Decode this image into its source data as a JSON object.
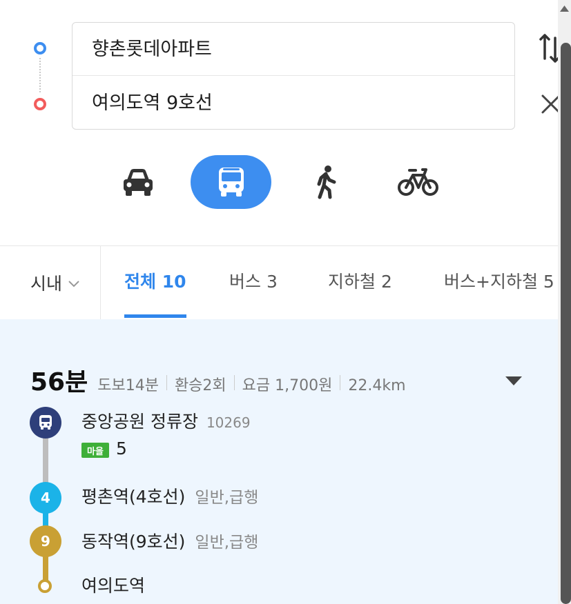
{
  "route": {
    "origin": "향촌롯데아파트",
    "destination": "여의도역 9호선",
    "swap_icon": "swap-vertical-icon",
    "clear_icon": "close-icon"
  },
  "modes": [
    {
      "name": "car",
      "icon": "car-icon",
      "selected": false
    },
    {
      "name": "transit",
      "icon": "bus-icon",
      "selected": true
    },
    {
      "name": "walk",
      "icon": "walk-icon",
      "selected": false
    },
    {
      "name": "bike",
      "icon": "bicycle-icon",
      "selected": false
    }
  ],
  "area_filter": "시내",
  "tabs": [
    {
      "label": "전체 10",
      "active": true
    },
    {
      "label": "버스 3",
      "active": false
    },
    {
      "label": "지하철 2",
      "active": false
    },
    {
      "label": "버스+지하철 5",
      "active": false
    }
  ],
  "result": {
    "duration": "56분",
    "walk": "도보14분",
    "transfers": "환승2회",
    "fare": "요금 1,700원",
    "distance": "22.4km",
    "steps": [
      {
        "kind": "bus",
        "name": "중앙공원 정류장",
        "stop_id": "10269",
        "badge": "마을",
        "route": "5"
      },
      {
        "kind": "subway",
        "line_label": "4",
        "name": "평촌역(4호선)",
        "type": "일반,급행",
        "color": "#1bb3e8"
      },
      {
        "kind": "subway",
        "line_label": "9",
        "name": "동작역(9호선)",
        "type": "일반,급행",
        "color": "#c9a034"
      },
      {
        "kind": "end",
        "name": "여의도역"
      }
    ]
  },
  "colors": {
    "accent": "#3d8ef0",
    "bus_step": "#2e3f7a",
    "line4": "#1bb3e8",
    "line9": "#c9a034",
    "village_bus": "#3eaf38"
  }
}
